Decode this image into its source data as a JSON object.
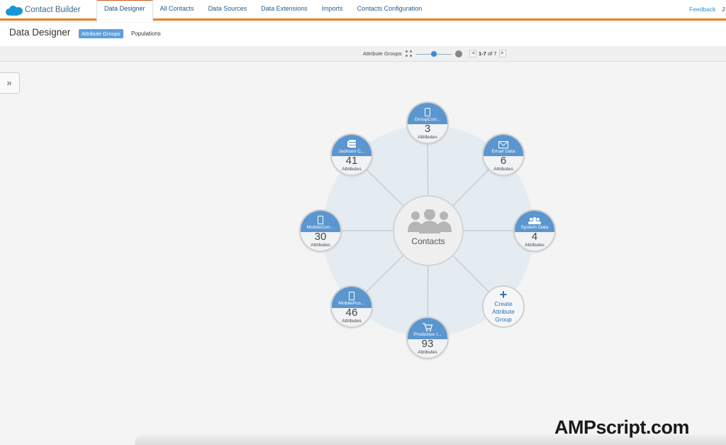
{
  "app": {
    "name": "Contact Builder",
    "brand_color": "#1b96d5",
    "accent_color": "#e8822a"
  },
  "nav": {
    "tabs": [
      {
        "label": "Data Designer",
        "active": true
      },
      {
        "label": "All Contacts",
        "active": false
      },
      {
        "label": "Data Sources",
        "active": false
      },
      {
        "label": "Data Extensions",
        "active": false
      },
      {
        "label": "Imports",
        "active": false
      },
      {
        "label": "Contacts Configuration",
        "active": false
      }
    ],
    "feedback": "Feedback",
    "user_initial": "J"
  },
  "subheader": {
    "title": "Data Designer",
    "views": [
      {
        "label": "Attribute Groups",
        "active": true
      },
      {
        "label": "Populations",
        "active": false
      }
    ]
  },
  "toolbar": {
    "label": "Attribute Groups",
    "zoom_level": 0.5,
    "pagination": {
      "range": "1-7",
      "of_text": "of 7"
    }
  },
  "diagram": {
    "center": {
      "label": "Contacts",
      "icon": "people-icon"
    },
    "attributes_label": "Attributes",
    "groups": [
      {
        "name": "GroupCon...",
        "count": "3",
        "icon": "mobile-icon"
      },
      {
        "name": "Email Data",
        "count": "6",
        "icon": "envelope-icon"
      },
      {
        "name": "System Data",
        "count": "4",
        "icon": "people-icon"
      },
      {
        "name": "Predictive I...",
        "count": "93",
        "icon": "cart-icon"
      },
      {
        "name": "MobilePus...",
        "count": "46",
        "icon": "mobile-icon"
      },
      {
        "name": "MobileCon...",
        "count": "30",
        "icon": "mobile-icon"
      },
      {
        "name": "Jackson C...",
        "count": "41",
        "icon": "database-icon"
      }
    ],
    "create": {
      "line1": "Create",
      "line2": "Attribute",
      "line3": "Group"
    }
  },
  "watermark": "AMPscript.com"
}
